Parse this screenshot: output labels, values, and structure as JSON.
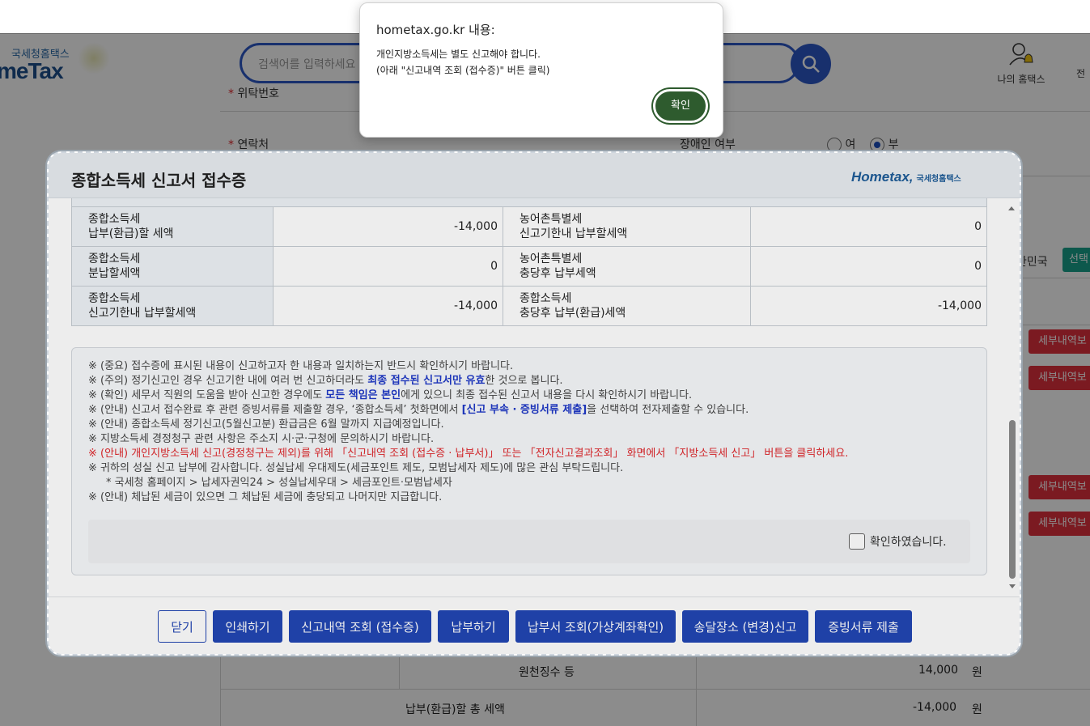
{
  "header": {
    "logo_small": "국세청홈택스",
    "logo_big": "meTax",
    "search_placeholder": "검색어를 입력하세요",
    "my_hometax": "나의 홈택스",
    "right_cut": "전"
  },
  "background_form": {
    "row1_label": "위탁번호",
    "row2_label": "연락처",
    "disabled_label": "장애인 여부",
    "option_yes": "여",
    "option_no": "부",
    "country": "한민국",
    "select_btn": "선택",
    "detail_btn": "세부내역보",
    "withholding_label": "원천징수 등",
    "withholding_value": "14,000",
    "total_label": "납부(환급)할 총 세액",
    "total_value": "-14,000",
    "unit": "원"
  },
  "modal": {
    "title": "종합소득세 신고서 접수증",
    "logo_text": "Hometax,",
    "logo_sub": "국세청홈택스",
    "table_rows": [
      {
        "label1_l1": "종합소득세",
        "label1_l2": "납부(환급)할 세액",
        "value1": "-14,000",
        "label2_l1": "농어촌특별세",
        "label2_l2": "신고기한내 납부할세액",
        "value2": "0"
      },
      {
        "label1_l1": "종합소득세",
        "label1_l2": "분납할세액",
        "value1": "0",
        "label2_l1": "농어촌특별세",
        "label2_l2": "충당후 납부세액",
        "value2": "0"
      },
      {
        "label1_l1": "종합소득세",
        "label1_l2": "신고기한내 납부할세액",
        "value1": "-14,000",
        "label2_l1": "종합소득세",
        "label2_l2": "충당후 납부(환급)세액",
        "value2": "-14,000"
      }
    ],
    "notices": {
      "n1": "※ (중요) 접수증에 표시된 내용이 신고하고자 한 내용과 일치하는지 반드시 확인하시기 바랍니다.",
      "n2_a": "※ (주의) 정기신고인 경우 신고기한 내에 여러 번 신고하더라도 ",
      "n2_b": "최종 접수된 신고서만 유효",
      "n2_c": "한 것으로 봅니다.",
      "n3_a": "※ (확인) 세무서 직원의 도움을 받아 신고한 경우에도 ",
      "n3_b": "모든 책임은 본인",
      "n3_c": "에게 있으니 최종 접수된 신고서 내용을 다시 확인하시기 바랍니다.",
      "n4_a": "※ (안내) 신고서 접수완료 후 관련 증빙서류를 제출할 경우, ‘종합소득세’ 첫화면에서 ",
      "n4_b": "[신고 부속 · 증빙서류 제출]",
      "n4_c": "을 선택하여 전자제출할 수 있습니다.",
      "n5": "※ (안내) 종합소득세 정기신고(5월신고분) 환급금은 6월 말까지 지급예정입니다.",
      "n6": "※ 지방소득세 경정청구 관련 사항은 주소지 시·군·구청에 문의하시기 바랍니다.",
      "n7_a": "※ ",
      "n7_b": "(안내) 개인지방소득세 신고(경정청구는 제외)를 위해 「신고내역 조회 (접수증 · 납부서)」 또는 「전자신고결과조회」 화면에서 「지방소득세 신고」 버튼을 클릭하세요.",
      "n8": "※ 귀하의 성실 신고 납부에 감사합니다. 성실납세 우대제도(세금포인트 제도, 모범납세자 제도)에 많은 관심 부탁드립니다.",
      "n9": "* 국세청 홈페이지 > 납세자권익24 > 성실납세우대 > 세금포인트·모범납세자",
      "n10": "※ (안내) 체납된 세금이 있으면 그 체납된 세금에 충당되고 나머지만 지급합니다."
    },
    "confirm_label": "확인하였습니다.",
    "buttons": {
      "close": "닫기",
      "print": "인쇄하기",
      "history": "신고내역 조회 (접수증)",
      "pay": "납부하기",
      "bill": "납부서 조회(가상계좌확인)",
      "address": "송달장소 (변경)신고",
      "proof": "증빙서류 제출"
    }
  },
  "alert": {
    "title": "hometax.go.kr 내용:",
    "message1": "개인지방소득세는 별도 신고해야 합니다.",
    "message2": "(아래 \"신고내역 조회 (접수증)\" 버튼 클릭)",
    "ok": "확인"
  },
  "colors": {
    "primary_blue": "#2246b4",
    "alert_ok_green": "#2e5b2e",
    "warn_red": "#e0272c",
    "detail_red": "#e0303d",
    "select_teal": "#18a08a"
  }
}
